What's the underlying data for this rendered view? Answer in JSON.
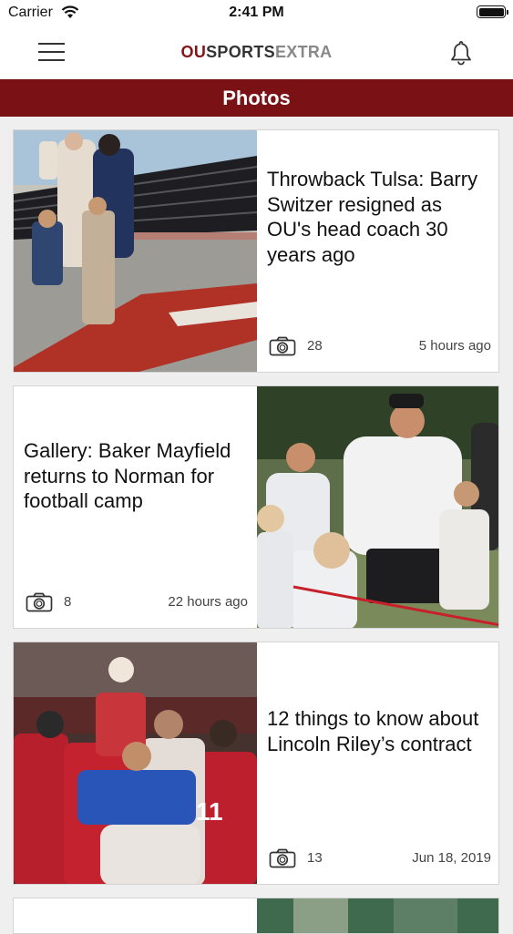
{
  "status_bar": {
    "carrier": "Carrier",
    "time": "2:41 PM"
  },
  "header": {
    "brand_ou": "OU",
    "brand_sports": "SPORTS",
    "brand_extra": "EXTRA"
  },
  "section": {
    "title": "Photos"
  },
  "articles": [
    {
      "title": "Throwback Tulsa: Barry Switzer resigned as OU's head coach 30 years ago",
      "photo_count": "28",
      "time": "5 hours ago",
      "image_side": "left"
    },
    {
      "title": "Gallery: Baker Mayfield returns to Norman for football camp",
      "photo_count": "8",
      "time": "22 hours ago",
      "image_side": "right"
    },
    {
      "title": "12 things to know about Lincoln Riley’s contract",
      "photo_count": "13",
      "time": "Jun 18, 2019",
      "image_side": "left"
    }
  ],
  "icons": {
    "menu": "hamburger-menu-icon",
    "bell": "bell-icon",
    "camera": "camera-icon",
    "wifi": "wifi-icon",
    "battery": "battery-icon"
  },
  "colors": {
    "brand": "#841617",
    "banner": "#7a1115"
  }
}
